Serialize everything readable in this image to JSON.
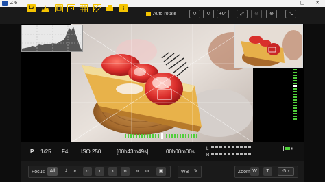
{
  "window": {
    "title": "Z 6",
    "minimize": "—",
    "maximize": "▢",
    "close": "✕"
  },
  "toolbar": {
    "lv_label": "Lv",
    "auto_rotate_label": "Auto rotate",
    "auto_rotate_checked": true,
    "rotate_value": "+0°",
    "icons": [
      "lv-icon",
      "histogram-icon",
      "focus-peaking-icon",
      "af-point-icon",
      "grid-icon",
      "highlight-icon",
      "level-icon",
      "info-icon"
    ]
  },
  "exposure": {
    "mode": "P",
    "shutter": "1/25",
    "aperture": "F4",
    "iso": "ISO 250",
    "remaining": "[00h43m49s]",
    "elapsed": "00h00m00s"
  },
  "audio": {
    "left_label": "L",
    "right_label": "R"
  },
  "controls": {
    "focus_label": "Focus",
    "focus_all": "All",
    "wb_label": "WB",
    "zoom_label": "Zoom",
    "zoom_w": "W",
    "zoom_t": "T",
    "exposure_comp": "-5"
  },
  "colors": {
    "accent": "#f5c400",
    "meter_green": "#4fcf3a"
  }
}
